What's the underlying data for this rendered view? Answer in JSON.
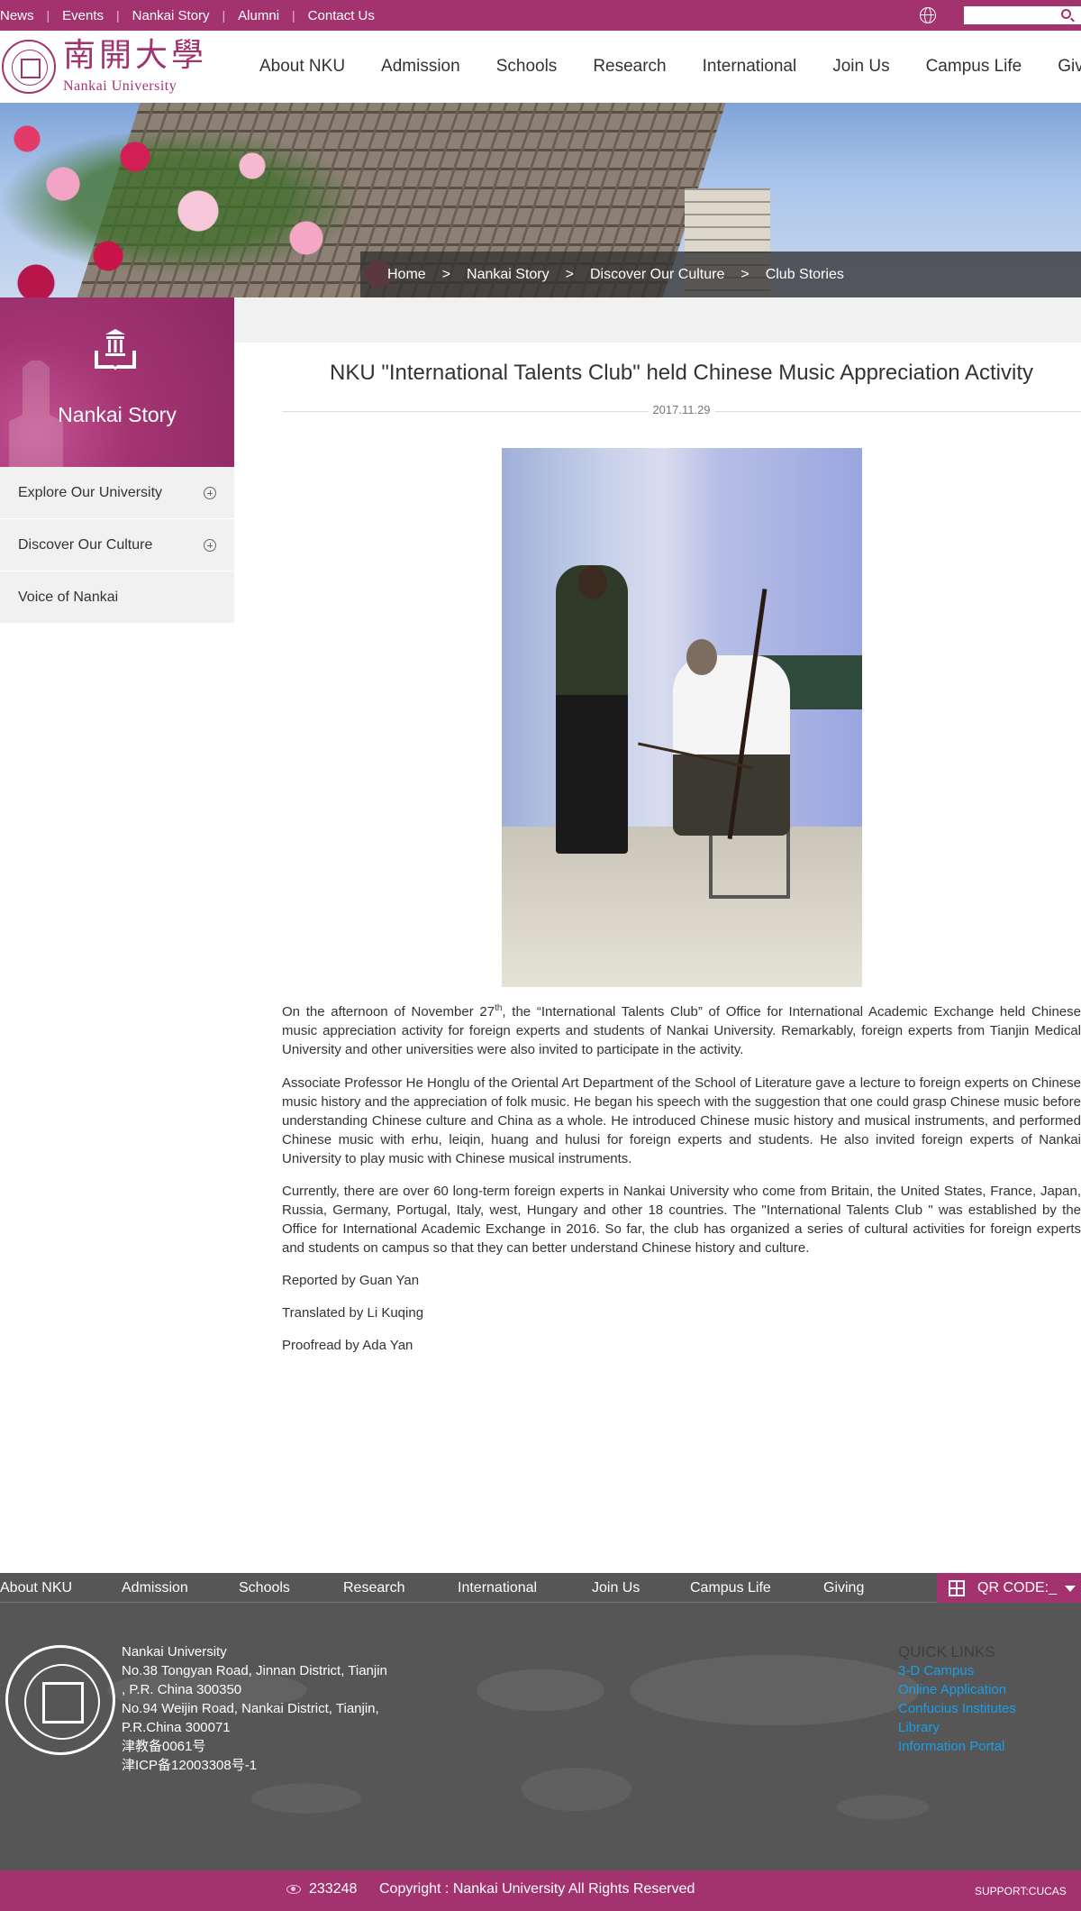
{
  "topbar": {
    "links": [
      "News",
      "Events",
      "Nankai Story",
      "Alumni",
      "Contact Us"
    ],
    "search_placeholder": ""
  },
  "header": {
    "logo_cn": "南開大學",
    "logo_en": "Nankai University",
    "nav": [
      "About NKU",
      "Admission",
      "Schools",
      "Research",
      "International",
      "Join Us",
      "Campus Life",
      "Giving"
    ]
  },
  "breadcrumb": [
    "Home",
    "Nankai Story",
    "Discover Our Culture",
    "Club Stories"
  ],
  "breadcrumb_separator": ">",
  "sidebar": {
    "title": "Nankai Story",
    "items": [
      {
        "label": "Explore Our University",
        "expandable": true
      },
      {
        "label": "Discover Our Culture",
        "expandable": true
      },
      {
        "label": "Voice of Nankai",
        "expandable": false
      }
    ]
  },
  "article": {
    "title": "NKU \"International Talents Club\" held Chinese Music Appreciation Activity",
    "date": "2017.11.29",
    "p1_before": "On the afternoon of November 27",
    "p1_sup": "th",
    "p1_after": ", the “International Talents Club” of Office for International Academic Exchange held Chinese music appreciation activity for foreign experts and students of Nankai University. Remarkably, foreign experts from Tianjin Medical University and other universities were also invited to participate in the activity.",
    "p2": "Associate Professor He Honglu of the Oriental Art Department of the School of Literature gave a lecture to foreign experts on Chinese music history and the appreciation of folk music. He began his speech with the suggestion that one could grasp Chinese music before understanding Chinese culture and China as a whole. He introduced Chinese music history and musical instruments, and performed Chinese music with erhu, leiqin, huang and hulusi for foreign experts and students. He also invited foreign experts of Nankai University to play music with Chinese musical instruments.",
    "p3": "Currently, there are over 60 long-term foreign experts in Nankai University who come from Britain, the United States, France, Japan, Russia, Germany, Portugal, Italy, west, Hungary and other 18 countries. The \"International Talents Club \" was established by the Office for International Academic Exchange in 2016. So far, the club has organized a series of cultural activities for foreign experts and students on campus so that they can better understand Chinese history and culture.",
    "reported": "Reported by Guan Yan",
    "translated": "Translated by Li Kuqing",
    "proofread": "Proofread by Ada Yan"
  },
  "footer": {
    "nav": [
      "About NKU",
      "Admission",
      "Schools",
      "Research",
      "International",
      "Join Us",
      "Campus Life",
      "Giving"
    ],
    "qr_label": "QR CODE:_",
    "address_lines": [
      "Nankai University",
      "No.38 Tongyan Road, Jinnan District, Tianjin",
      ", P.R. China 300350",
      "No.94 Weijin Road,  Nankai District, Tianjin,",
      "P.R.China  300071",
      "津教备0061号",
      "津ICP备12003308号-1"
    ],
    "quick_links_title": "QUICK LINKS",
    "quick_links": [
      "3-D Campus",
      "Online Application",
      "Confucius Institutes",
      "Library",
      "Information Portal"
    ],
    "link_color": "#1a9ee8"
  },
  "bottom": {
    "visits": "233248",
    "copyright": "Copyright : Nankai University All Rights Reserved",
    "support": "SUPPORT:CUCAS"
  },
  "colors": {
    "brand": "#a3336f",
    "footer_bg": "#565656",
    "sidebar_bg": "#f1f1f1"
  }
}
